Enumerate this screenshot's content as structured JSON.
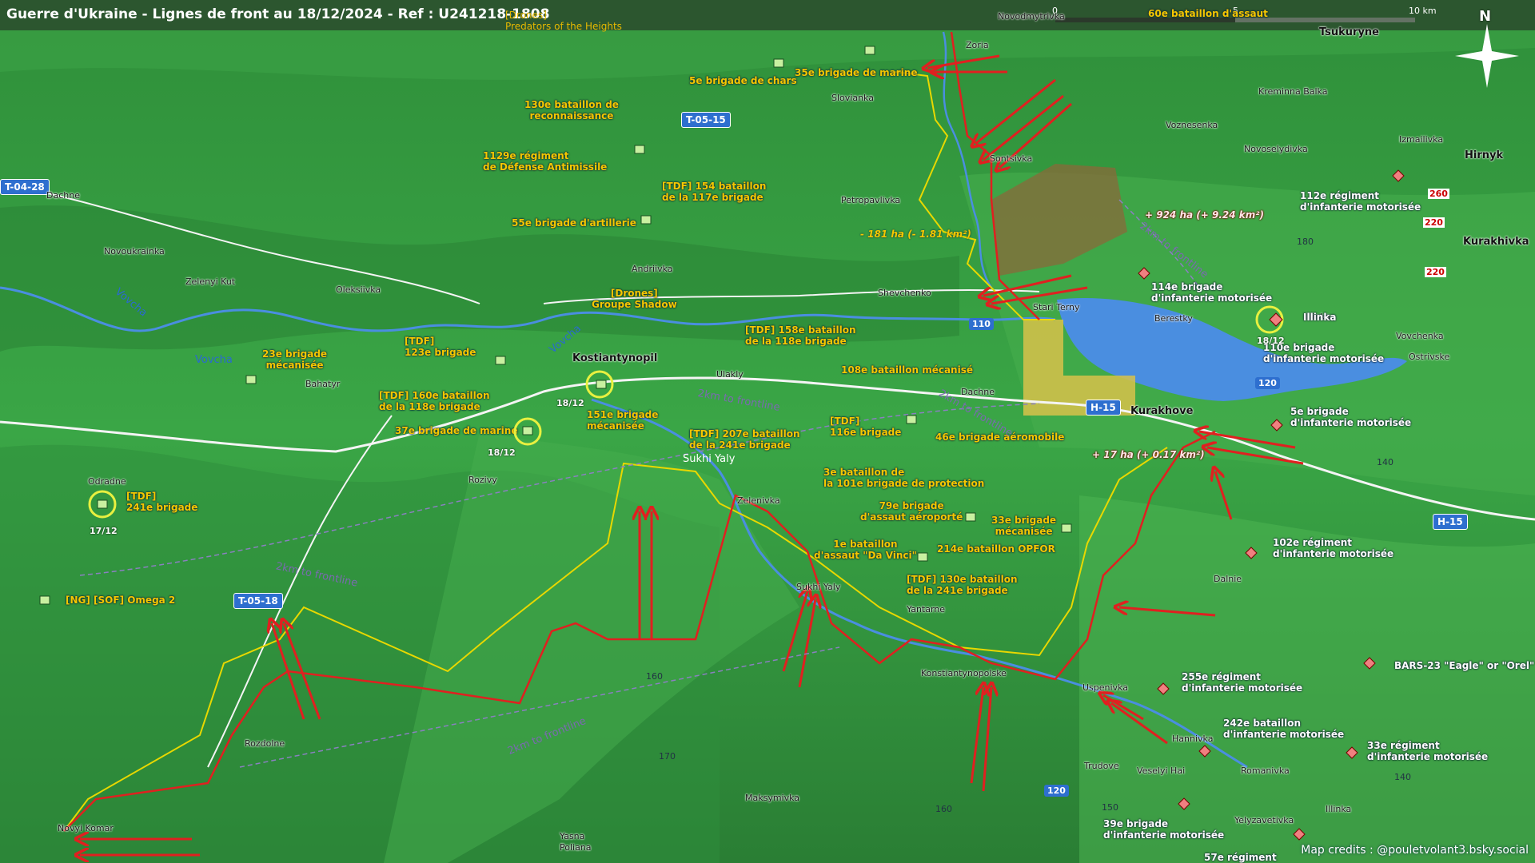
{
  "title": "Guerre d'Ukraine - Lignes de front au 18/12/2024 - Ref : U241218-1808",
  "top_tag": [
    "[Drones]",
    "Predators of the Heights"
  ],
  "scale": {
    "start": "0",
    "mid": "5",
    "end": "10 km"
  },
  "north": "N",
  "credits": "Map credits : @pouletvolant3.bsky.social",
  "roads": {
    "t0428": "T-04-28",
    "t0515": "T-05-15",
    "t0518": "T-05-18",
    "h15a": "H-15",
    "h15b": "H-15",
    "r110": "110",
    "r120a": "120",
    "r120b": "120",
    "r260": "260",
    "r220a": "220",
    "r220b": "220"
  },
  "towns": {
    "zoria": "Zoria",
    "tsukuryne": "Tsukuryne",
    "slovianka": "Slovianka",
    "kreminna": "Kreminna Balka",
    "voznesenka": "Voznesenka",
    "izmailivka": "Izmailivka",
    "novoselydivka": "Novoselydivka",
    "hirnyk": "Hirnyk",
    "sontsivka": "Sontsivka",
    "petropavlivka": "Petropavlivka",
    "kurakhivka": "Kurakhivka",
    "dachne_w": "Dachne",
    "novoukrainka": "Novoukrainka",
    "zelenyi": "Zelenyi Kut",
    "oleksiivka": "Oleksiivka",
    "andriivka": "Andriivka",
    "shevchenko": "Shevchenko",
    "stari": "Stari Terny",
    "berestky": "Berestky",
    "illinka": "Illinka",
    "vovchenka": "Vovchenka",
    "ostrivske": "Ostrivske",
    "bahatyr": "Bahatyr",
    "kostiantynopil": "Kostiantynopil",
    "ulakly": "Ulakly",
    "dachne_e": "Dachne",
    "kurakhove": "Kurakhove",
    "odradne": "Odradne",
    "rozivy": "Rozivy",
    "sukhi1": "Sukhi Yaly",
    "zelenivka": "Zelenivka",
    "sukhi2": "Sukhi Yaly",
    "yantarne": "Yantarne",
    "dalnie": "Dalnie",
    "konstpolske": "Konstiantynopolske",
    "uspenivka": "Uspenivka",
    "rozdolne": "Rozdolne",
    "hannivka": "Hannivka",
    "veselyi": "Veselyi Hai",
    "romanivka": "Romanivka",
    "trudove": "Trudove",
    "maksymivka": "Maksymivka",
    "yasna": [
      "Yasna",
      "Poliana"
    ],
    "novyi": "Novyi Komar",
    "yelyzavetivka": "Yelyzavetivka",
    "illinka2": "Illinka",
    "novodmytrivka": "Novodmytrivka",
    "vovcha1": "Vovcha",
    "vovcha2": "Vovcha",
    "vovcha3": "Vovcha",
    "sukhi_river": "Sukhi Yaly",
    "dachne_top": "Dachne"
  },
  "units_ua": {
    "u1": [
      "[Drones]",
      "Groupe Shadow"
    ],
    "u2": [
      "35e brigade de marine"
    ],
    "u3": [
      "5e brigade de chars"
    ],
    "u4": [
      "130e bataillon de",
      "reconnaissance"
    ],
    "u5": [
      "1129e régiment",
      "de Défense Antimissile"
    ],
    "u6": [
      "[TDF] 154 bataillon",
      "de la 117e brigade"
    ],
    "u7": [
      "55e brigade d'artillerie"
    ],
    "u8": [
      "[TDF]",
      "123e brigade"
    ],
    "u9": [
      "23e brigade",
      "mécanisée"
    ],
    "u10": [
      "[TDF] 160e bataillon",
      "de la 118e brigade"
    ],
    "u11": [
      "37e brigade de marine"
    ],
    "u12": [
      "151e brigade",
      "mécanisée"
    ],
    "u13": [
      "[TDF] 158e bataillon",
      "de la 118e brigade"
    ],
    "u14": [
      "108e bataillon mécanisé"
    ],
    "u15": [
      "[TDF]",
      "116e brigade"
    ],
    "u16": [
      "[TDF] 207e bataillon",
      "de la 241e brigade"
    ],
    "u17": [
      "46e brigade aéromobile"
    ],
    "u18": [
      "[TDF]",
      "241e brigade"
    ],
    "u19": [
      "3e bataillon de",
      "la 101e brigade de protection"
    ],
    "u20": [
      "79e brigade",
      "d'assaut aéroporté"
    ],
    "u21": [
      "33e brigade",
      "mécanisée"
    ],
    "u22": [
      "1e bataillon",
      "d'assaut \"Da Vinci\""
    ],
    "u23": [
      "214e bataillon OPFOR"
    ],
    "u24": [
      "[TDF] 130e bataillon",
      "de la 241e brigade"
    ],
    "u25": [
      "[NG] [SOF] Omega 2"
    ],
    "u26": [
      "60e bataillon d'assaut"
    ]
  },
  "units_ru": {
    "r1": [
      "112e régiment",
      "d'infanterie motorisée"
    ],
    "r2": [
      "114e brigade",
      "d'infanterie motorisée"
    ],
    "r3": [
      "110e brigade",
      "d'infanterie motorisée"
    ],
    "r4": [
      "5e brigade",
      "d'infanterie motorisée"
    ],
    "r5": [
      "102e régiment",
      "d'infanterie motorisée"
    ],
    "r6": [
      "BARS-23 \"Eagle\" or \"Orel\""
    ],
    "r7": [
      "255e régiment",
      "d'infanterie motorisée"
    ],
    "r8": [
      "242e bataillon",
      "d'infanterie motorisée"
    ],
    "r9": [
      "33e régiment",
      "d'infanterie motorisée"
    ],
    "r10": [
      "39e brigade",
      "d'infanterie motorisée"
    ],
    "r11": [
      "57e régiment"
    ],
    "r12": [
      "Illinka"
    ]
  },
  "areas": {
    "gain_big": "+ 924 ha (+ 9.24 km²)",
    "loss": "- 181 ha (- 1.81 km²)",
    "gain_small": "+ 17 ha (+ 0.17 km²)"
  },
  "dates": {
    "d1": "18/12",
    "d2": "18/12",
    "d3": "17/12",
    "d4": "18/12"
  },
  "buffer": {
    "b1": "2km to frontline",
    "b2": "2km to frontline",
    "b3": "2km to frontline",
    "b4": "2km to frontline",
    "b5": "2km to frontline"
  },
  "elevations": {
    "e1": "180",
    "e2": "140",
    "e3": "160",
    "e4": "170",
    "e5": "160",
    "e6": "150",
    "e7": "140"
  },
  "colors": {
    "front_ru": "#e02020",
    "front_ua": "#e8d800",
    "water": "#4a8ee0",
    "gain_area": "#8a6a3a",
    "terrain_dark": "#1f6f2a",
    "terrain_light": "#5cc05a"
  }
}
